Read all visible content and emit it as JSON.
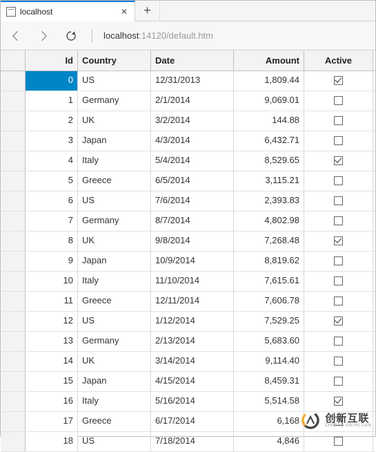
{
  "tab": {
    "title": "localhost"
  },
  "url": {
    "host": "localhost",
    "rest": ":14120/default.htm"
  },
  "grid": {
    "headers": {
      "id": "Id",
      "country": "Country",
      "date": "Date",
      "amount": "Amount",
      "active": "Active"
    },
    "rows": [
      {
        "id": "0",
        "country": "US",
        "date": "12/31/2013",
        "amount": "1,809.44",
        "active": true,
        "selected": true
      },
      {
        "id": "1",
        "country": "Germany",
        "date": "2/1/2014",
        "amount": "9,069.01",
        "active": false
      },
      {
        "id": "2",
        "country": "UK",
        "date": "3/2/2014",
        "amount": "144.88",
        "active": false
      },
      {
        "id": "3",
        "country": "Japan",
        "date": "4/3/2014",
        "amount": "6,432.71",
        "active": false
      },
      {
        "id": "4",
        "country": "Italy",
        "date": "5/4/2014",
        "amount": "8,529.65",
        "active": true
      },
      {
        "id": "5",
        "country": "Greece",
        "date": "6/5/2014",
        "amount": "3,115.21",
        "active": false
      },
      {
        "id": "6",
        "country": "US",
        "date": "7/6/2014",
        "amount": "2,393.83",
        "active": false
      },
      {
        "id": "7",
        "country": "Germany",
        "date": "8/7/2014",
        "amount": "4,802.98",
        "active": false
      },
      {
        "id": "8",
        "country": "UK",
        "date": "9/8/2014",
        "amount": "7,268.48",
        "active": true
      },
      {
        "id": "9",
        "country": "Japan",
        "date": "10/9/2014",
        "amount": "8,819.62",
        "active": false
      },
      {
        "id": "10",
        "country": "Italy",
        "date": "11/10/2014",
        "amount": "7,615.61",
        "active": false
      },
      {
        "id": "11",
        "country": "Greece",
        "date": "12/11/2014",
        "amount": "7,606.78",
        "active": false
      },
      {
        "id": "12",
        "country": "US",
        "date": "1/12/2014",
        "amount": "7,529.25",
        "active": true
      },
      {
        "id": "13",
        "country": "Germany",
        "date": "2/13/2014",
        "amount": "5,683.60",
        "active": false
      },
      {
        "id": "14",
        "country": "UK",
        "date": "3/14/2014",
        "amount": "9,114.40",
        "active": false
      },
      {
        "id": "15",
        "country": "Japan",
        "date": "4/15/2014",
        "amount": "8,459.31",
        "active": false
      },
      {
        "id": "16",
        "country": "Italy",
        "date": "5/16/2014",
        "amount": "5,514.58",
        "active": true
      },
      {
        "id": "17",
        "country": "Greece",
        "date": "6/17/2014",
        "amount": "6,168",
        "active": false
      },
      {
        "id": "18",
        "country": "US",
        "date": "7/18/2014",
        "amount": "4,846",
        "active": false
      }
    ]
  },
  "watermark": {
    "cn": "创新互联",
    "en": "CHUANG XIN HU LIAN"
  }
}
